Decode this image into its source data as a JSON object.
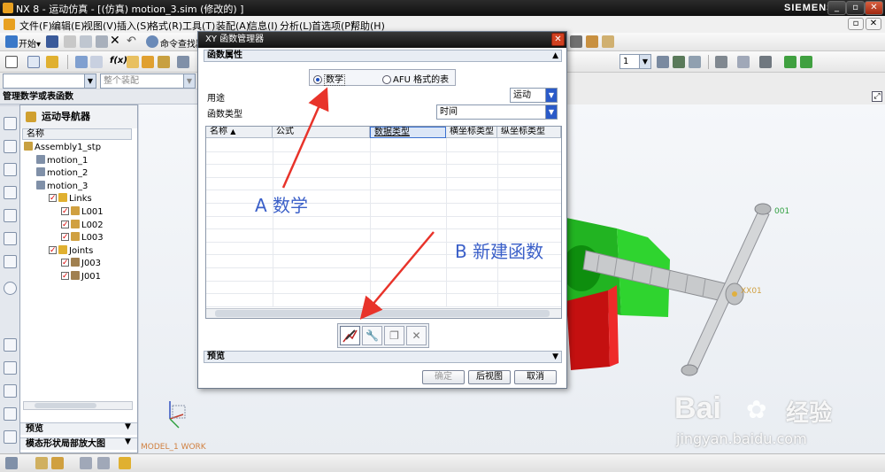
{
  "window": {
    "title": "NX 8 - 运动仿真 - [(仿真) motion_3.sim  (修改的) ]",
    "brand": "SIEMENS",
    "controls": [
      "_",
      "▫",
      "✕"
    ]
  },
  "menu": [
    "文件(F)",
    "编辑(E)",
    "视图(V)",
    "插入(S)",
    "格式(R)",
    "工具(T)",
    "装配(A)",
    "信息(I)",
    "分析(L)",
    "首选项(P)",
    "帮助(H)"
  ],
  "toolbar": {
    "start_label": "开始▾",
    "command_finder": "命令查找器",
    "filter_placeholder": "整个装配",
    "layer_value": "1"
  },
  "left_panel": {
    "title": "管理数学或表函数",
    "navigator_title": "运动导航器",
    "column_name": "名称",
    "tree": [
      {
        "label": "Assembly1_stp",
        "indent": 0,
        "type": "asm"
      },
      {
        "label": "motion_1",
        "indent": 1,
        "type": "motion"
      },
      {
        "label": "motion_2",
        "indent": 1,
        "type": "motion"
      },
      {
        "label": "motion_3",
        "indent": 1,
        "type": "motion"
      },
      {
        "label": "Links",
        "indent": 2,
        "type": "folder"
      },
      {
        "label": "L001",
        "indent": 3,
        "type": "link"
      },
      {
        "label": "L002",
        "indent": 3,
        "type": "link"
      },
      {
        "label": "L003",
        "indent": 3,
        "type": "link"
      },
      {
        "label": "Joints",
        "indent": 2,
        "type": "folder"
      },
      {
        "label": "J003",
        "indent": 3,
        "type": "joint"
      },
      {
        "label": "J001",
        "indent": 3,
        "type": "joint"
      }
    ],
    "footer_preview": "预览",
    "footer_model": "模态形状局部放大图"
  },
  "dialog": {
    "title": "XY 函数管理器",
    "section_props": "函数属性",
    "radio_math": "数学",
    "radio_afu": "AFU 格式的表",
    "usage_label": "用途",
    "usage_value": "运动",
    "type_label": "函数类型",
    "type_value": "时间",
    "columns": [
      "名称",
      "公式",
      "数据类型",
      "横坐标类型",
      "纵坐标类型"
    ],
    "section_preview": "预览",
    "btn_ok": "确定",
    "btn_back": "后视图",
    "btn_cancel": "取消"
  },
  "annotations": {
    "a": "A  数学",
    "b": "B  新建函数"
  },
  "viewport": {
    "model_label": "MODEL_1 WORK",
    "tag_1": "001",
    "tag_2": "XX01"
  },
  "watermark": {
    "brand": "Bai",
    "brand_tail": "经验",
    "url": "jingyan.baidu.com"
  },
  "colors": {
    "accent": "#1e50c0",
    "annotation": "#3a5fc8",
    "arrow": "#e8332a"
  }
}
